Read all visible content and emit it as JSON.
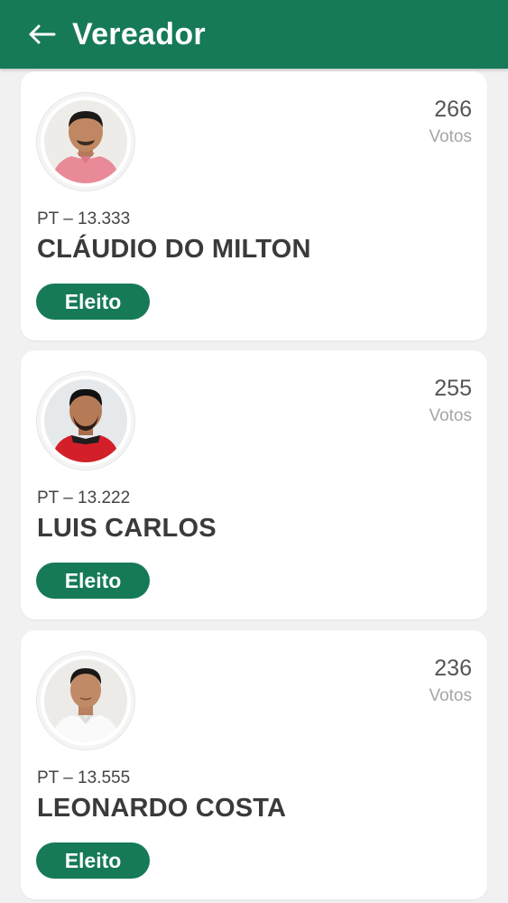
{
  "header": {
    "title": "Vereador",
    "back_icon": "arrow-left-icon",
    "background_color": "#167a57"
  },
  "candidates": [
    {
      "party_number": "PT – 13.333",
      "name": "CLÁUDIO DO MILTON",
      "votes": "266",
      "votes_label": "Votos",
      "status": "Eleito"
    },
    {
      "party_number": "PT – 13.222",
      "name": "LUIS CARLOS",
      "votes": "255",
      "votes_label": "Votos",
      "status": "Eleito"
    },
    {
      "party_number": "PT – 13.555",
      "name": "LEONARDO COSTA",
      "votes": "236",
      "votes_label": "Votos",
      "status": "Eleito"
    }
  ],
  "colors": {
    "accent": "#167a57",
    "card_background": "#ffffff",
    "page_background": "#f1f1f1"
  }
}
